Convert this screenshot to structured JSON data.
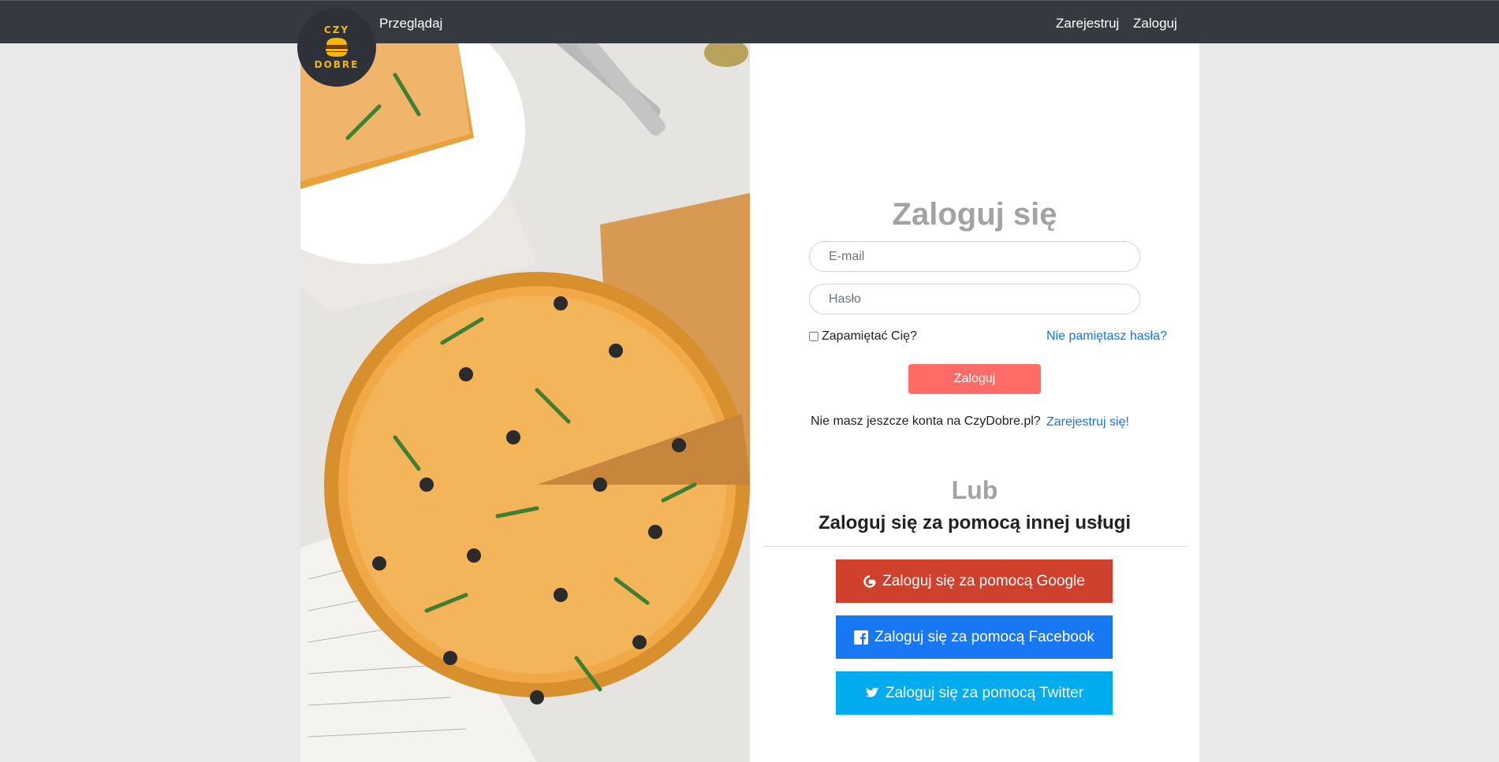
{
  "logo": {
    "top_text": "CZY",
    "bottom_text": "DOBRE",
    "accent_color": "#f5b70a"
  },
  "navbar": {
    "browse_label": "Przeglądaj",
    "register_label": "Zarejestruj",
    "login_label": "Zaloguj",
    "background": "#343a40"
  },
  "login_form": {
    "title": "Zaloguj się",
    "email_placeholder": "E-mail",
    "password_placeholder": "Hasło",
    "remember_label": "Zapamiętać Cię?",
    "forgot_label": "Nie pamiętasz hasła?",
    "submit_label": "Zaloguj",
    "submit_color": "#ff6b66",
    "no_account_text": "Nie masz jeszcze konta na CzyDobre.pl?",
    "register_link": "Zarejestruj się!"
  },
  "social": {
    "or_text": "Lub",
    "title": "Zaloguj się za pomocą innej usługi",
    "google_label": "Zaloguj się za pomocą Google",
    "facebook_label": "Zaloguj się za pomocą Facebook",
    "twitter_label": "Zaloguj się za pomocą Twitter",
    "google_color": "#d0412d",
    "facebook_color": "#1877f2",
    "twitter_color": "#00acee"
  },
  "icons": {
    "google": "google-icon",
    "facebook": "facebook-icon",
    "twitter": "twitter-icon",
    "burger": "burger-icon"
  }
}
